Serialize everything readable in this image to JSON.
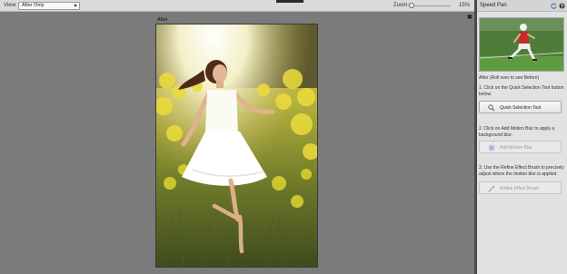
{
  "toolbar": {
    "view_label": "View:",
    "view_value": "After Only",
    "zoom_label": "Zoom:",
    "zoom_value": "15%",
    "zoom_fraction": 0.15
  },
  "canvas": {
    "after_caption": "After",
    "close_icon": "close-icon",
    "photo": "woman-dancing-in-white-dress-field"
  },
  "panel": {
    "title": "Speed Pan",
    "icons": [
      "refresh-icon",
      "help-icon"
    ],
    "thumbnail": "baseball-player-running",
    "thumb_caption": "After (Roll over to see Before)",
    "step1": "1. Click on the Quick Selection Tool button below.",
    "button1": "Quick Selection Tool",
    "step2": "2. Click on Add Motion Blur to apply a background blur.",
    "button2": "Add Motion Blur",
    "step3": "3. Use the Refine Effect Brush to precisely adjust where the motion blur is applied.",
    "button3": "Refine Effect Brush"
  }
}
